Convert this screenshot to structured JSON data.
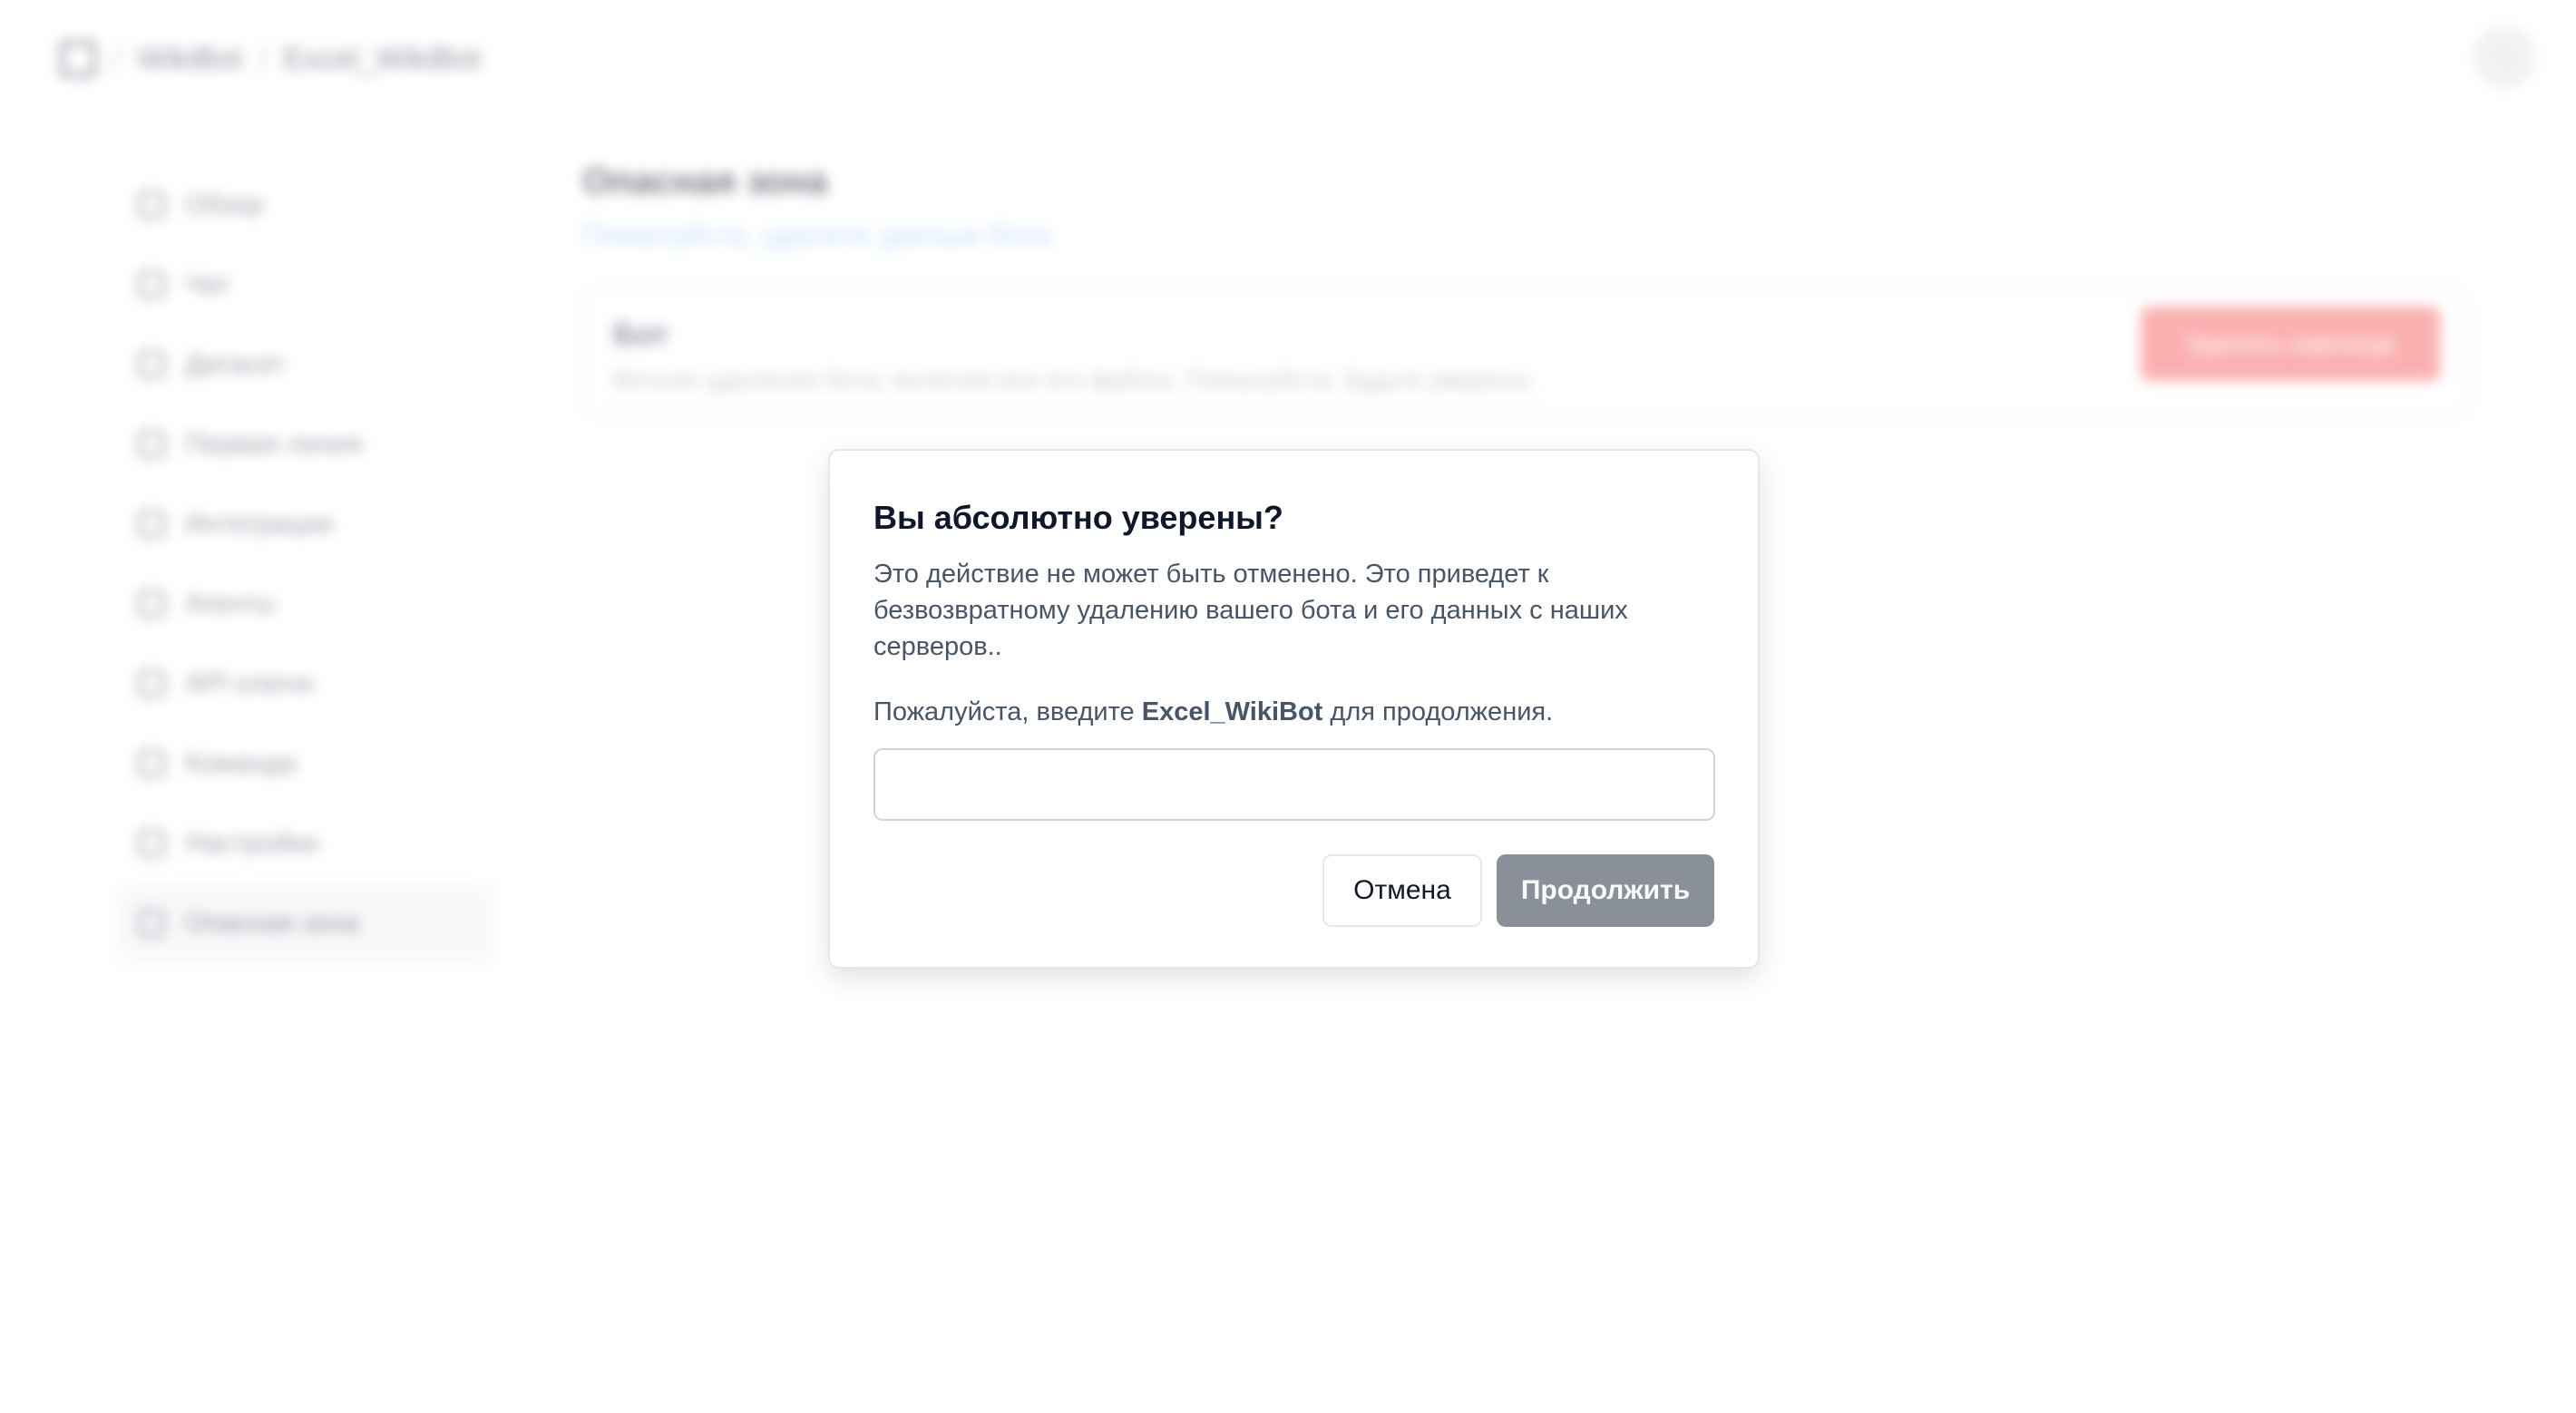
{
  "header": {
    "breadcrumb": [
      "WikiBot",
      "Excel_WikiBot"
    ]
  },
  "sidebar": {
    "items": [
      {
        "label": "Обзор",
        "icon": "activity-icon"
      },
      {
        "label": "Чат",
        "icon": "chat-icon"
      },
      {
        "label": "Датасет",
        "icon": "database-icon"
      },
      {
        "label": "Первая линия",
        "icon": "route-icon"
      },
      {
        "label": "Интеграции",
        "icon": "plug-icon"
      },
      {
        "label": "Агенты",
        "icon": "bot-icon"
      },
      {
        "label": "API ключи",
        "icon": "key-icon"
      },
      {
        "label": "Команда",
        "icon": "users-icon"
      },
      {
        "label": "Настройки",
        "icon": "settings-icon"
      },
      {
        "label": "Опасная зона",
        "icon": "warning-icon",
        "active": true
      }
    ]
  },
  "main": {
    "title": "Опасная зона",
    "subtitle": "Пожалуйста, удалите данные бота",
    "card": {
      "title": "Бот",
      "description": "Вечное удаление бота, включая все его файлы. Пожалуйста, будьте уверены.",
      "button_label": "Удалить навсегда"
    }
  },
  "modal": {
    "title": "Вы абсолютно уверены?",
    "description": "Это действие не может быть отменено. Это приведет к безвозвратному удалению вашего бота и его данных с наших серверов..",
    "prompt_before": "Пожалуйста, введите ",
    "prompt_bot_name": "Excel_WikiBot",
    "prompt_after": " для продолжения.",
    "input_value": "",
    "cancel_label": "Отмена",
    "continue_label": "Продолжить"
  },
  "colors": {
    "continue_button": "#8a9099",
    "danger": "#f87171"
  }
}
